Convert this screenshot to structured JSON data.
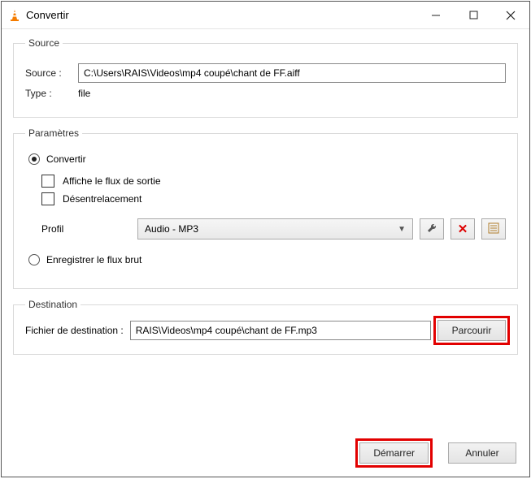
{
  "window": {
    "title": "Convertir"
  },
  "source": {
    "legend": "Source",
    "source_label": "Source :",
    "source_value": "C:\\Users\\RAIS\\Videos\\mp4 coupé\\chant de FF.aiff",
    "type_label": "Type :",
    "type_value": "file"
  },
  "params": {
    "legend": "Paramètres",
    "radio_convert": "Convertir",
    "chk_show_output": "Affiche le flux de sortie",
    "chk_deinterlace": "Désentrelacement",
    "profile_label": "Profil",
    "profile_value": "Audio - MP3",
    "radio_raw": "Enregistrer le flux brut"
  },
  "dest": {
    "legend": "Destination",
    "label": "Fichier de destination :",
    "value": "RAIS\\Videos\\mp4 coupé\\chant de FF.mp3",
    "browse": "Parcourir"
  },
  "footer": {
    "start": "Démarrer",
    "cancel": "Annuler"
  },
  "colors": {
    "highlight": "#e20000"
  }
}
